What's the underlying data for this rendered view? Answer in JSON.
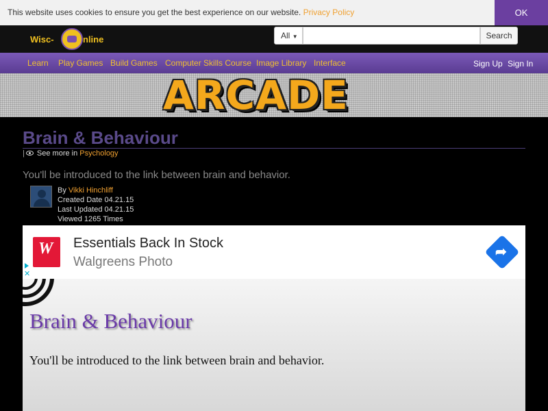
{
  "cookie": {
    "message": "This website uses cookies to ensure you get the best experience on our website.",
    "link": "Privacy Policy",
    "ok": "OK"
  },
  "header": {
    "logo_left": "Wisc-",
    "logo_right": "nline",
    "search_category": "All",
    "search_value": "",
    "search_button": "Search"
  },
  "nav": {
    "items": [
      "Learn",
      "Play Games",
      "Build Games",
      "Computer Skills Course",
      "Image Library",
      "Interface"
    ],
    "signup": "Sign Up",
    "signin": "Sign In"
  },
  "banner": {
    "text": "ARCADE"
  },
  "page": {
    "title": "Brain & Behaviour",
    "see_more": "See more in",
    "category": "Psychology",
    "description": "You'll be introduced to the link between brain and behavior.",
    "author_prefix": "By",
    "author": "Vikki Hinchliff",
    "created": "Created Date 04.21.15",
    "updated": "Last Updated 04.21.15",
    "views": "Viewed 1265 Times"
  },
  "ad": {
    "logo_letter": "W",
    "title": "Essentials Back In Stock",
    "subtitle": "Walgreens Photo",
    "close": "✕"
  },
  "slide": {
    "title": "Brain & Behaviour",
    "text": "You'll be introduced to the link between brain and behavior."
  },
  "colors": {
    "accent": "#f0a030",
    "purple": "#6b3fa0"
  }
}
